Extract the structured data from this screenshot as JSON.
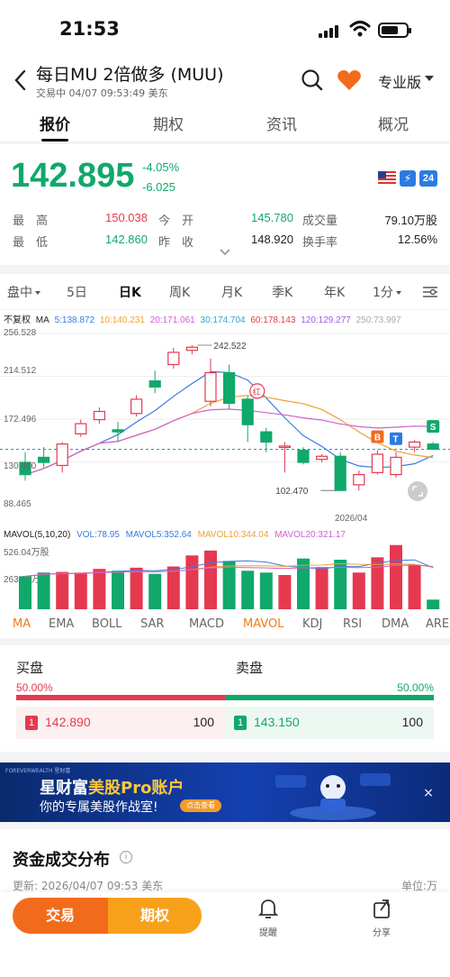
{
  "status": {
    "time": "21:53"
  },
  "header": {
    "title": "每日MU 2倍做多 (MUU)",
    "subtitle": "交易中 04/07 09:53:49  美东",
    "pro_label": "专业版"
  },
  "tabs": [
    "报价",
    "期权",
    "资讯",
    "概况"
  ],
  "quote": {
    "price": "142.895",
    "change_pct": "-4.05%",
    "change": "-6.025",
    "badge_24": "24",
    "badge_bolt": "⚡",
    "stats": {
      "high_label": "最　高",
      "high": "150.038",
      "low_label": "最　低",
      "low": "142.860",
      "open_label": "今　开",
      "open": "145.780",
      "prev_label": "昨　收",
      "prev": "148.920",
      "vol_label": "成交量",
      "vol": "79.10万股",
      "turnover_label": "换手率",
      "turnover": "12.56%"
    }
  },
  "periods": [
    "盘中",
    "5日",
    "日K",
    "周K",
    "月K",
    "季K",
    "年K",
    "1分"
  ],
  "chart": {
    "adjust_label": "不复权",
    "ma_label": "MA",
    "ma5": "5:138.872",
    "ma10": "10:140.231",
    "ma20": "20:171.061",
    "ma30": "30:174.704",
    "ma60": "60:178.143",
    "ma120": "120:129.277",
    "ma250": "250:73.997",
    "y_labels": [
      "256.528",
      "214.512",
      "172.496",
      "130.480",
      "88.465"
    ],
    "high_mark": "242.522",
    "low_mark": "102.470",
    "date_label": "2026/04",
    "marker_red": "红",
    "marker_b": "B",
    "marker_t": "T",
    "marker_s": "S",
    "vol_title": "MAVOL(5,10,20)",
    "vol": "VOL:78.95",
    "vol5": "MAVOL5:352.64",
    "vol10": "MAVOL10:344.04",
    "vol20": "MAVOL20:321.17",
    "vol_y1": "526.04万股",
    "vol_y2": "263.02万股",
    "colors": {
      "up": "#e53950",
      "down": "#11a86b"
    }
  },
  "chart_data": {
    "type": "candlestick",
    "series": [
      {
        "name": "K",
        "values": [
          {
            "o": 130,
            "c": 118,
            "h": 140,
            "l": 112
          },
          {
            "o": 135,
            "c": 130,
            "h": 145,
            "l": 125
          },
          {
            "o": 127,
            "c": 148,
            "h": 150,
            "l": 120
          },
          {
            "o": 158,
            "c": 168,
            "h": 172,
            "l": 155
          },
          {
            "o": 172,
            "c": 180,
            "h": 184,
            "l": 168
          },
          {
            "o": 162,
            "c": 160,
            "h": 170,
            "l": 150
          },
          {
            "o": 178,
            "c": 192,
            "h": 196,
            "l": 175
          },
          {
            "o": 210,
            "c": 204,
            "h": 220,
            "l": 198
          },
          {
            "o": 226,
            "c": 238,
            "h": 242.522,
            "l": 222
          },
          {
            "o": 240,
            "c": 243,
            "h": 245,
            "l": 236
          },
          {
            "o": 190,
            "c": 218,
            "h": 232,
            "l": 185
          },
          {
            "o": 218,
            "c": 188,
            "h": 226,
            "l": 182
          },
          {
            "o": 192,
            "c": 167,
            "h": 195,
            "l": 150
          },
          {
            "o": 160,
            "c": 150,
            "h": 164,
            "l": 140
          },
          {
            "o": 145,
            "c": 146,
            "h": 150,
            "l": 120
          },
          {
            "o": 142,
            "c": 130,
            "h": 145,
            "l": 128
          },
          {
            "o": 133,
            "c": 136,
            "h": 138,
            "l": 130
          },
          {
            "o": 136,
            "c": 102.47,
            "h": 140,
            "l": 102.47
          },
          {
            "o": 108,
            "c": 118,
            "h": 122,
            "l": 102.5
          },
          {
            "o": 120,
            "c": 138,
            "h": 142,
            "l": 118
          },
          {
            "o": 118,
            "c": 135,
            "h": 140,
            "l": 115
          },
          {
            "o": 145,
            "c": 150,
            "h": 152,
            "l": 140
          },
          {
            "o": 148,
            "c": 142.895,
            "h": 150.038,
            "l": 142.86
          }
        ]
      }
    ],
    "ylim": [
      88.465,
      256.528
    ],
    "volumes": [
      270,
      300,
      305,
      300,
      330,
      315,
      340,
      290,
      350,
      440,
      480,
      395,
      315,
      300,
      280,
      415,
      345,
      405,
      300,
      425,
      525,
      365,
      78.95
    ]
  },
  "indicators": [
    "MA",
    "EMA",
    "BOLL",
    "SAR",
    "MACD",
    "MAVOL",
    "KDJ",
    "RSI",
    "DMA",
    "ARE"
  ],
  "book": {
    "bid_title": "买盘",
    "ask_title": "卖盘",
    "bid_pct": "50.00%",
    "ask_pct": "50.00%",
    "bid_level": "1",
    "bid_price": "142.890",
    "bid_qty": "100",
    "ask_level": "1",
    "ask_price": "143.150",
    "ask_qty": "100"
  },
  "banner": {
    "small": "FOREVERWEALTH 星财富",
    "title_prefix": "星财富",
    "title_highlight": "美股Pro账户",
    "subtitle": "你的专属美股作战室!",
    "cta": "点击查看",
    "close": "×"
  },
  "flow": {
    "title": "资金成交分布",
    "info": "i",
    "update": "更新: 2026/04/07 09:53 美东",
    "unit": "单位:万"
  },
  "bottom": {
    "trade": "交易",
    "options": "期权",
    "remind": "提醒",
    "share": "分享"
  }
}
